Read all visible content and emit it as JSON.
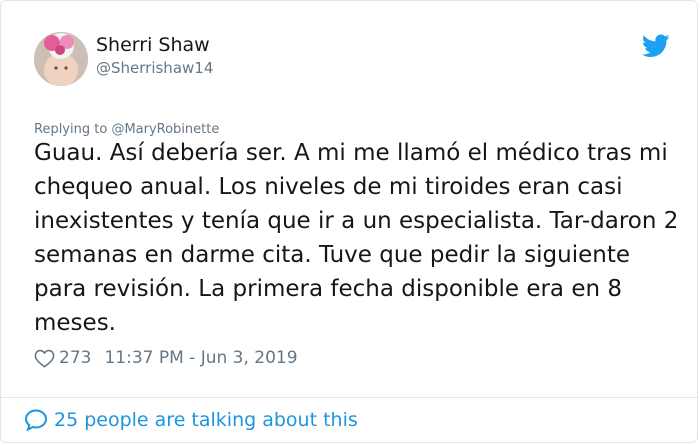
{
  "tweet": {
    "author_name": "Sherri Shaw",
    "author_handle": "@Sherrishaw14",
    "reply_prefix": "Replying to",
    "reply_to": "@MaryRobinette",
    "text": "Guau. Así debería ser. A mi me llamó el médico tras mi chequeo anual. Los niveles de mi tiroides eran casi inexistentes y tenía que ir a un especialista. Tar-daron 2 semanas en darme cita. Tuve que pedir la siguiente para revisión. La primera fecha disponible era en 8 meses.",
    "likes": "273",
    "timestamp": "11:37 PM - Jun 3, 2019",
    "footer": "25 people are talking about this"
  },
  "colors": {
    "accent": "#1da1f2",
    "link": "#1b95e0",
    "muted": "#657786",
    "text": "#14171a",
    "border": "#e1e8ed"
  },
  "icons": {
    "brand": "twitter-bird-icon",
    "like": "heart-icon",
    "conversation": "speech-bubble-icon"
  }
}
